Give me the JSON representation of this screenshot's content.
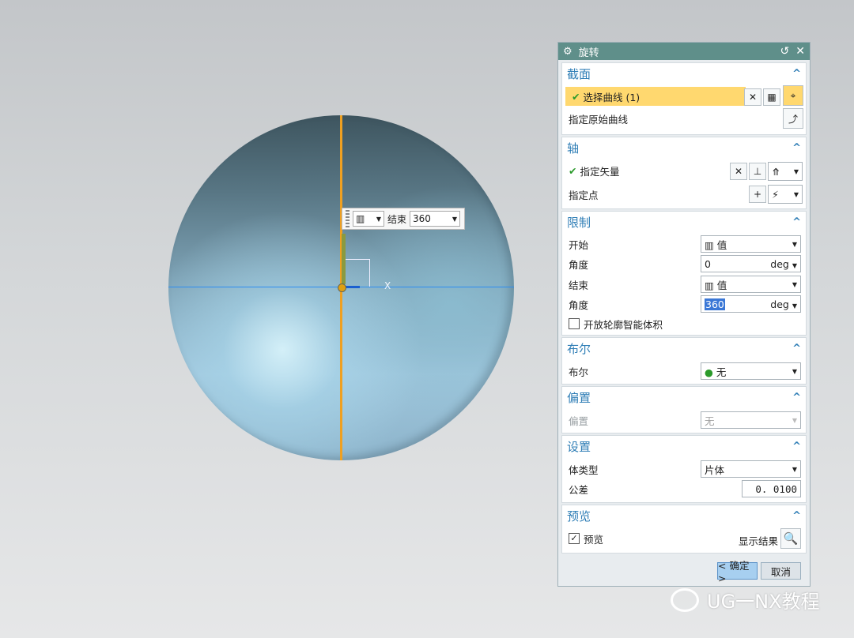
{
  "viewport": {
    "axis_label": "X",
    "floating_bar": {
      "label": "结束",
      "value": "360"
    }
  },
  "dialog": {
    "title": "旋转",
    "sections": {
      "section": {
        "title": "截面",
        "select_curve": "选择曲线 (1)",
        "specify_original": "指定原始曲线"
      },
      "axis": {
        "title": "轴",
        "specify_vector": "指定矢量",
        "specify_point": "指定点"
      },
      "limits": {
        "title": "限制",
        "start_label": "开始",
        "start_value": "值",
        "angle1_label": "角度",
        "angle1_value": "0",
        "angle1_unit": "deg",
        "end_label": "结束",
        "end_value": "值",
        "angle2_label": "角度",
        "angle2_value": "360",
        "angle2_unit": "deg",
        "open_profile": "开放轮廓智能体积"
      },
      "boolean": {
        "title": "布尔",
        "label": "布尔",
        "value": "无"
      },
      "offset": {
        "title": "偏置",
        "label": "偏置",
        "value": "无"
      },
      "settings": {
        "title": "设置",
        "body_type_label": "体类型",
        "body_type_value": "片体",
        "tolerance_label": "公差",
        "tolerance_value": "0. 0100"
      },
      "preview": {
        "title": "预览",
        "preview_label": "预览",
        "show_result": "显示结果"
      }
    },
    "buttons": {
      "ok": "< 确定 >",
      "cancel": "取消"
    }
  },
  "watermark": "UG一NX教程",
  "colors": {
    "title_bar": "#5f8f8a",
    "accent": "#2f7eb6",
    "selection": "#ffd86f",
    "axis_orange": "#f0a020"
  }
}
